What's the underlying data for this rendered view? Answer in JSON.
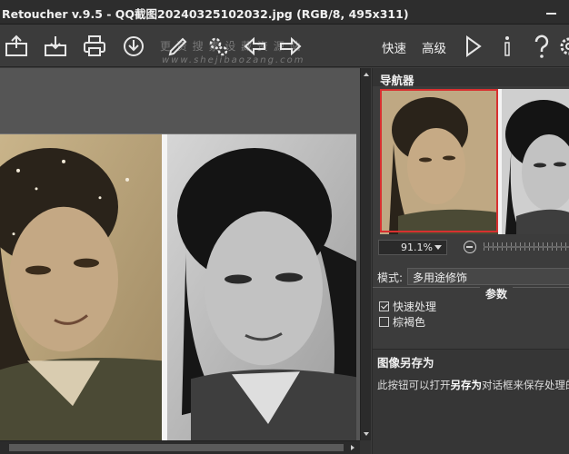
{
  "window": {
    "title": "Retoucher v.9.5 - QQ截图20240325102032.jpg (RGB/8, 495x311)"
  },
  "toolbar": {
    "icons": [
      "open-icon",
      "save-icon",
      "print-icon",
      "download-icon",
      "brush-icon",
      "settings-icon",
      "undo-icon",
      "redo-icon",
      "play-icon",
      "info-icon",
      "help-icon",
      "gear-icon"
    ],
    "quick_label": "快速",
    "advanced_label": "高级",
    "watermark_line1": "更 资 搜 素 设 藏 资 源 站",
    "watermark_line2": "www.shejibaozang.com"
  },
  "navigator": {
    "title": "导航器",
    "zoom_value": "91.1%"
  },
  "mode": {
    "label": "模式:",
    "value": "多用途修饰"
  },
  "params": {
    "label": "参数",
    "options": [
      {
        "label": "快速处理",
        "checked": true
      },
      {
        "label": "棕褐色",
        "checked": false
      }
    ]
  },
  "help": {
    "title": "图像另存为",
    "text_prefix": "此按钮可以打开",
    "text_bold": "另存为",
    "text_suffix": "对话框来保存处理的"
  },
  "colors": {
    "accent_frame": "#d83030",
    "background": "#3c3c3c"
  }
}
